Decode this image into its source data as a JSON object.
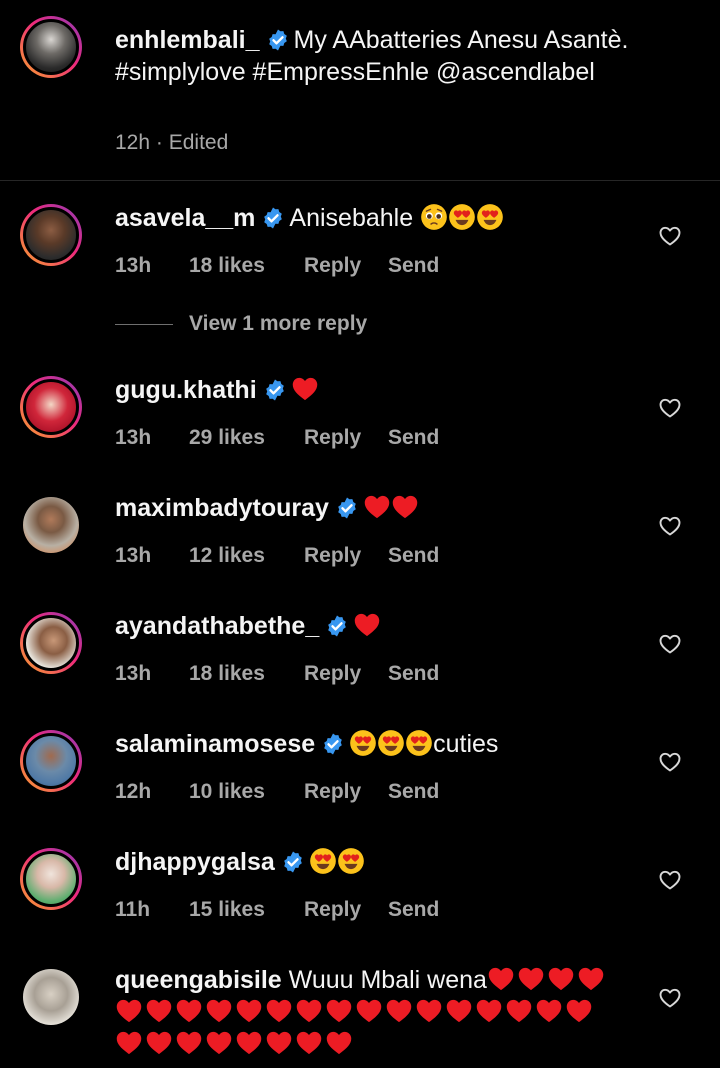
{
  "caption": {
    "username": "enhlembali_",
    "text": "My AAbatteries Anesu Asantè. #simplylove #EmpressEnhle @ascendlabel",
    "time": "12h",
    "separator": "·",
    "edited": "Edited"
  },
  "view_more_replies": "View 1 more reply",
  "labels": {
    "reply": "Reply",
    "send": "Send"
  },
  "comments": [
    {
      "username": "asavela__m",
      "text": "Anisebahle",
      "emojis": [
        "pleading",
        "heart-eyes",
        "heart-eyes"
      ],
      "time": "13h",
      "likes": "18 likes"
    },
    {
      "username": "gugu.khathi",
      "text": "",
      "emojis": [
        "red-heart"
      ],
      "time": "13h",
      "likes": "29 likes"
    },
    {
      "username": "maximbadytouray",
      "text": "",
      "emojis": [
        "red-heart",
        "red-heart"
      ],
      "time": "13h",
      "likes": "12 likes"
    },
    {
      "username": "ayandathabethe_",
      "text": "",
      "emojis": [
        "red-heart"
      ],
      "time": "13h",
      "likes": "18 likes"
    },
    {
      "username": "salaminamosese",
      "text": "cuties",
      "emojis": [
        "heart-eyes",
        "heart-eyes",
        "heart-eyes"
      ],
      "time": "12h",
      "likes": "10 likes"
    },
    {
      "username": "djhappygalsa",
      "text": "",
      "emojis": [
        "heart-eyes",
        "heart-eyes"
      ],
      "time": "11h",
      "likes": "15 likes"
    },
    {
      "username": "queengabisile",
      "text": "Wuuu Mbali wena",
      "emoji_lines": [
        4,
        16,
        8
      ]
    }
  ],
  "colors": {
    "verified": "#3897f0",
    "heart": "#ed1c24",
    "ring_start": "#f9a52c",
    "ring_end": "#8a3ab9",
    "meta": "#a8a8a8"
  }
}
